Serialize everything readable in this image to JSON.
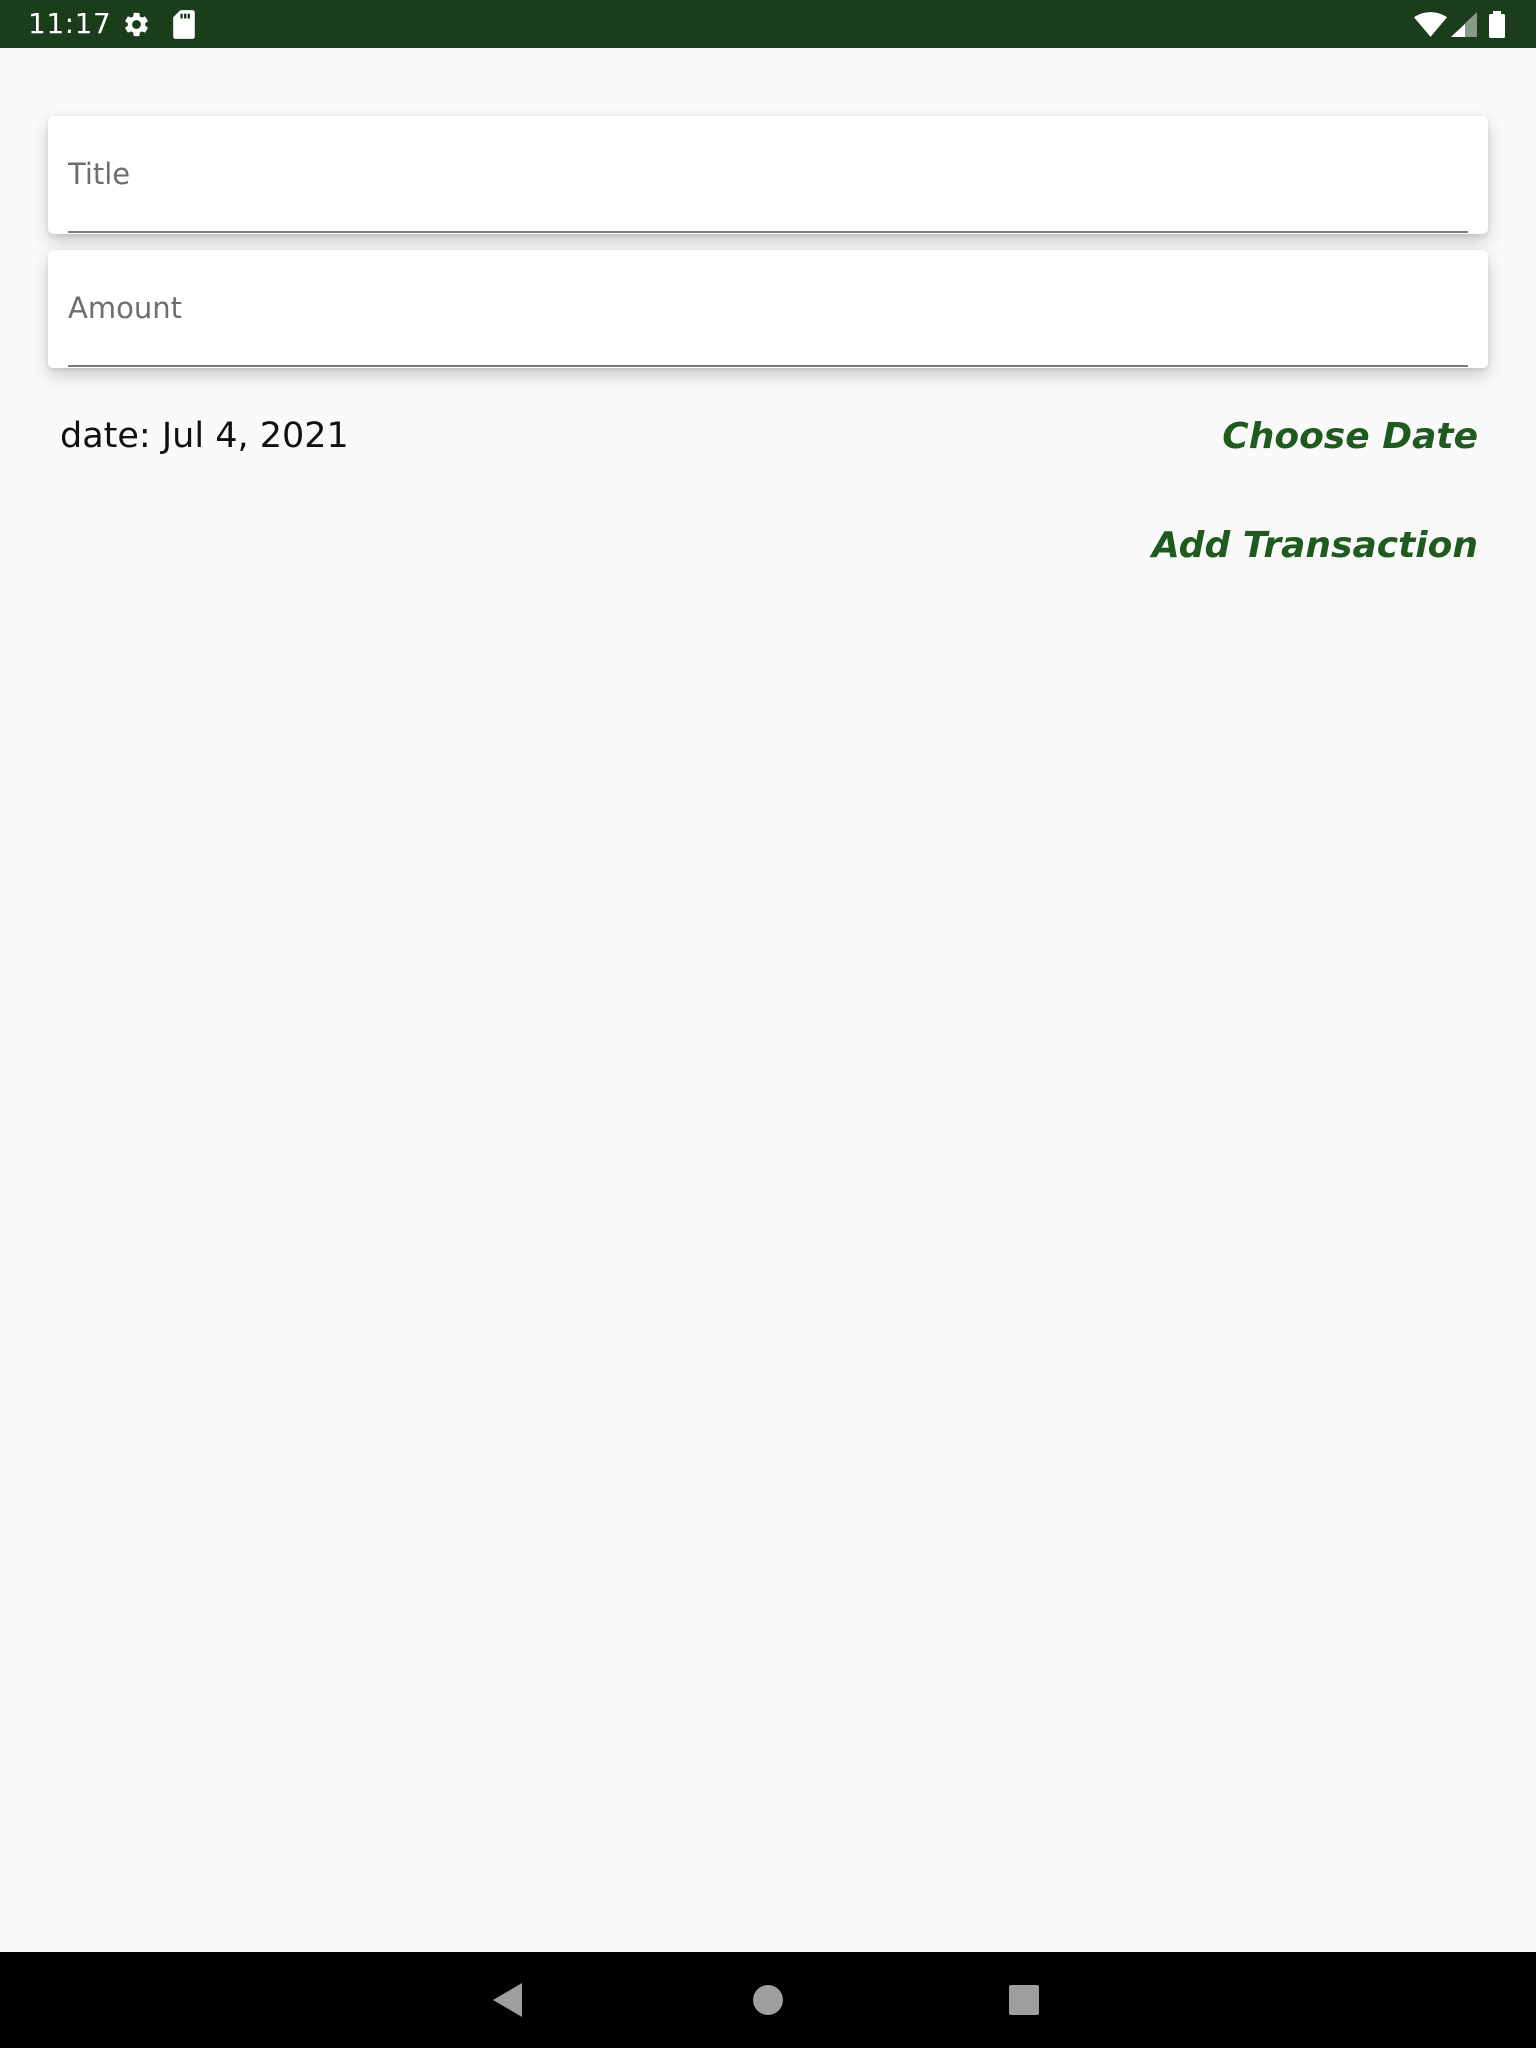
{
  "status_bar": {
    "time": "11:17",
    "icons": [
      "gear-icon",
      "sd-card-icon",
      "wifi-icon",
      "signal-icon",
      "battery-icon"
    ],
    "background_color": "#1b3d1c"
  },
  "form": {
    "title_field": {
      "placeholder": "Title",
      "value": ""
    },
    "amount_field": {
      "placeholder": "Amount",
      "value": ""
    },
    "date_label": "date: Jul 4, 2021",
    "choose_date_label": "Choose Date",
    "add_transaction_label": "Add Transaction",
    "accent_color": "#1f5a1f"
  },
  "nav_bar": {
    "icons": [
      "back-icon",
      "home-icon",
      "recents-icon"
    ]
  }
}
